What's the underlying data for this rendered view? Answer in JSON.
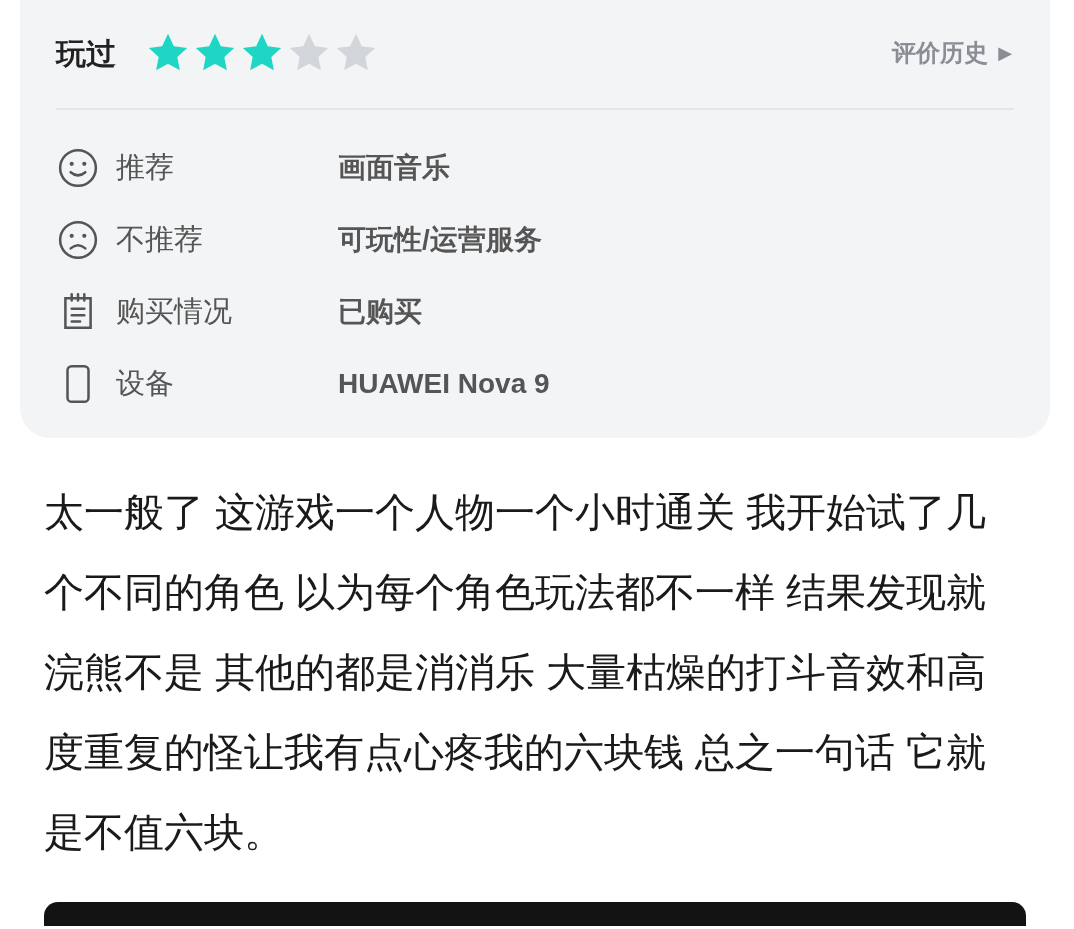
{
  "rating": {
    "label": "玩过",
    "stars": 3,
    "history_link": "评价历史",
    "history_arrow": "▶"
  },
  "details": [
    {
      "kind": "like",
      "label": "推荐",
      "value": "画面音乐"
    },
    {
      "kind": "dislike",
      "label": "不推荐",
      "value": "可玩性/运营服务"
    },
    {
      "kind": "purchase",
      "label": "购买情况",
      "value": "已购买"
    },
    {
      "kind": "device",
      "label": "设备",
      "value": "HUAWEI Nova 9"
    }
  ],
  "review_text": "太一般了 这游戏一个人物一个小时通关 我开始试了几个不同的角色 以为每个角色玩法都不一样 结果发现就浣熊不是 其他的都是消消乐 大量枯燥的打斗音效和高度重复的怪让我有点心疼我的六块钱 总之一句话 它就是不值六块。"
}
